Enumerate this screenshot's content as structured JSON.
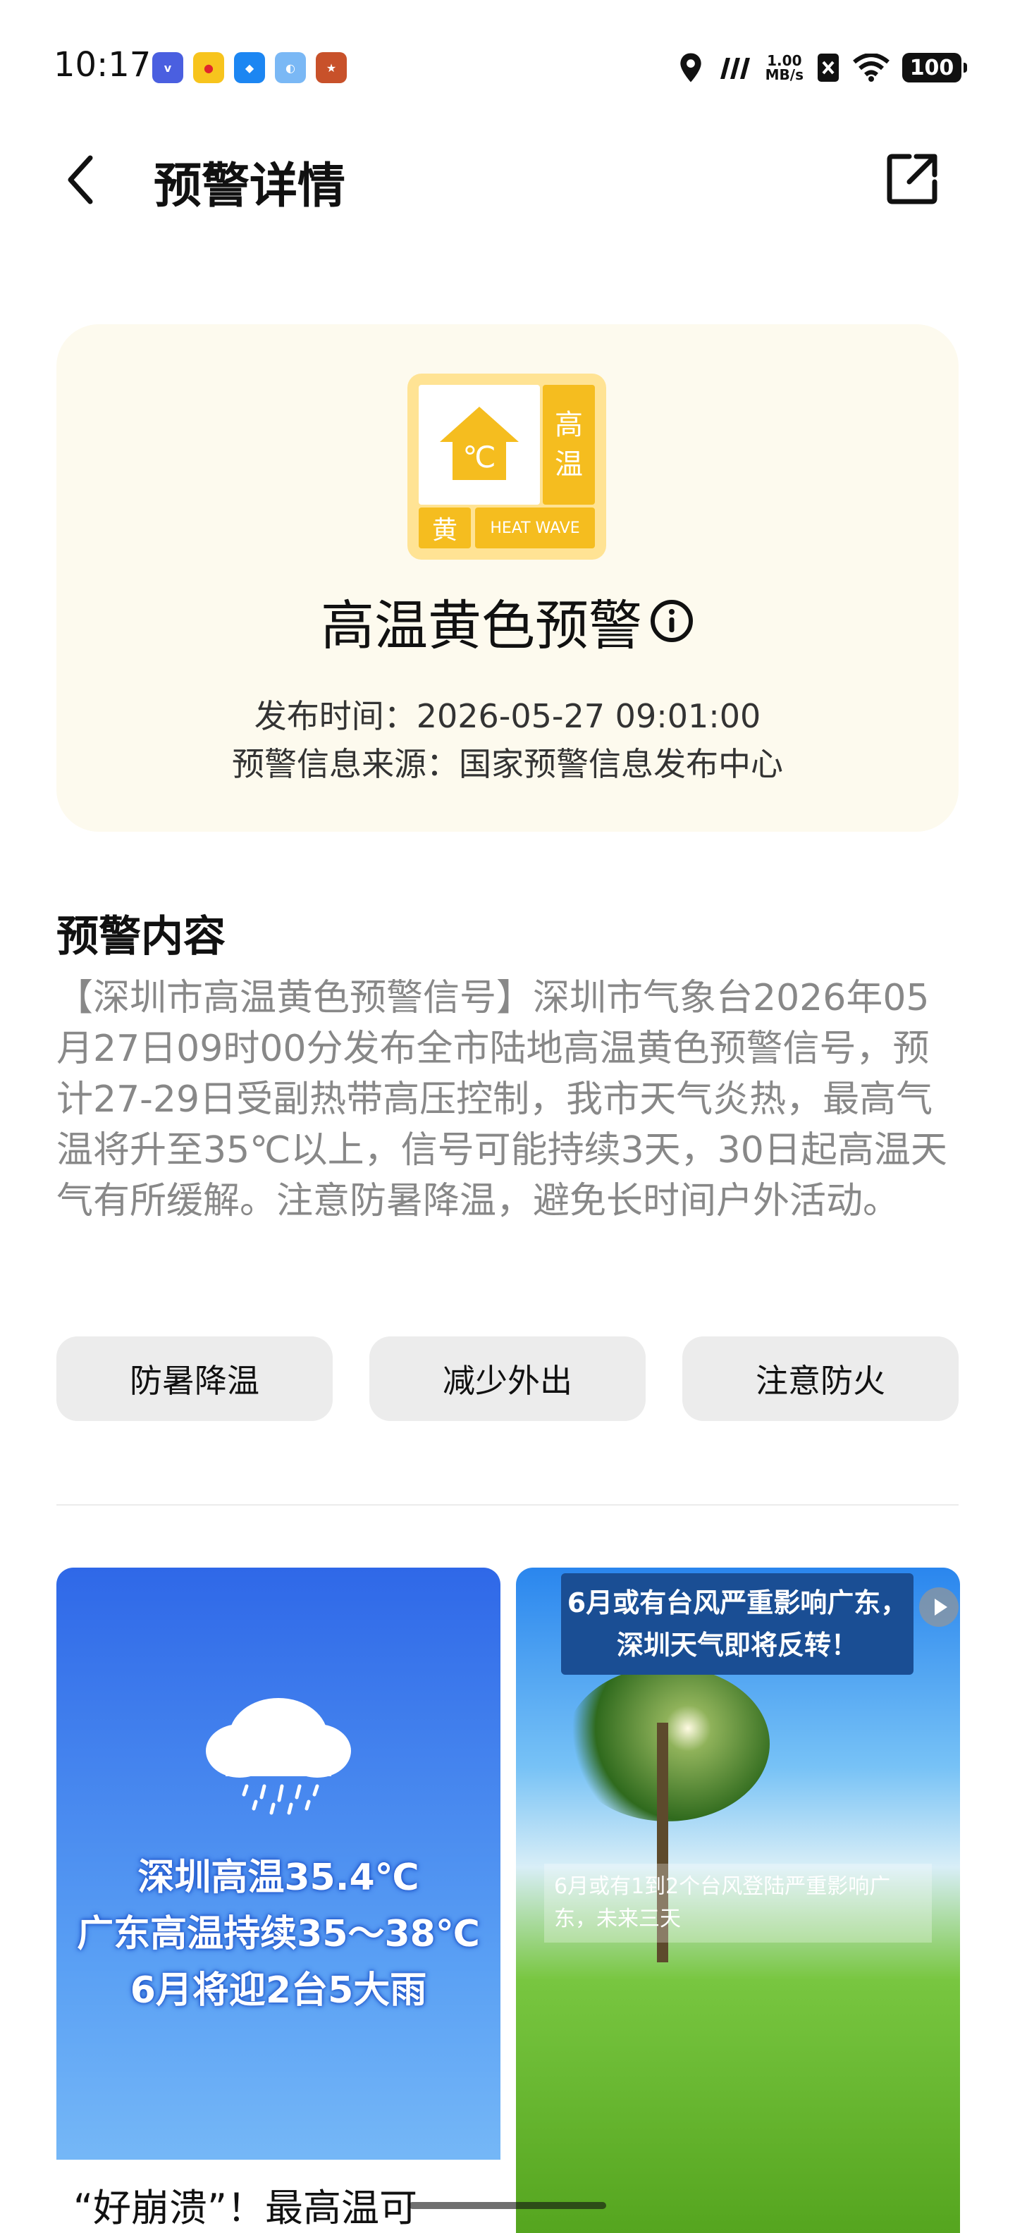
{
  "status_bar": {
    "time": "10:17",
    "app_icons": [
      "vivo",
      "weibo",
      "browser",
      "assistant",
      "game"
    ],
    "network_speed_value": "1.00",
    "network_speed_unit": "MB/s",
    "battery": "100"
  },
  "header": {
    "title": "预警详情"
  },
  "warning": {
    "badge_side_line1": "高",
    "badge_side_line2": "温",
    "badge_level": "黄",
    "badge_english": "HEAT WAVE",
    "badge_symbol": "℃",
    "title": "高温黄色预警",
    "publish_time": "发布时间：2026-05-27 09:01:00",
    "source": "预警信息来源：国家预警信息发布中心",
    "colors": {
      "level": "#f5bd1f",
      "card_bg": "#fdfaee"
    }
  },
  "content": {
    "section_title": "预警内容",
    "text": "【深圳市高温黄色预警信号】深圳市气象台2026年05月27日09时00分发布全市陆地高温黄色预警信号，预计27-29日受副热带高压控制，我市天气炎热，最高气温将升至35℃以上，信号可能持续3天，30日起高温天气有所缓解。注意防暑降温，避免长时间户外活动。"
  },
  "tags": [
    "防暑降温",
    "减少外出",
    "注意防火"
  ],
  "articles": {
    "left": {
      "line1": "深圳高温35.4℃",
      "line2": "广东高温持续35～38℃",
      "line3": "6月将迎2台5大雨",
      "caption": "“好崩溃”！最高温可"
    },
    "right": {
      "headline_line1": "6月或有台风严重影响广东，",
      "headline_line2": "深圳天气即将反转！",
      "subtitle": "6月或有1到2个台风登陆严重影响广东，未来三天"
    }
  }
}
